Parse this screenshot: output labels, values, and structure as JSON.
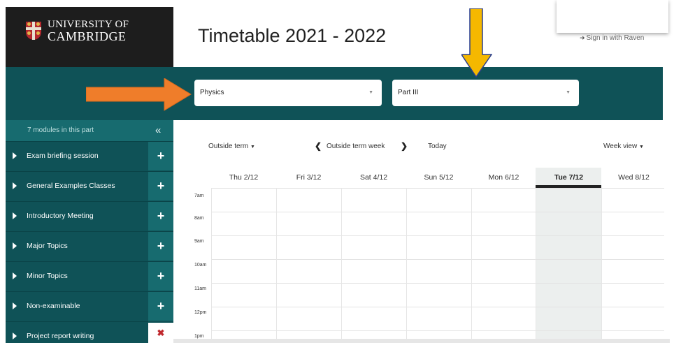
{
  "header": {
    "university_line1": "UNIVERSITY OF",
    "university_line2": "CAMBRIDGE",
    "title": "Timetable 2021 - 2022",
    "signin_label": "Sign in with Raven",
    "signin_icon": "sign-in-icon"
  },
  "filters": {
    "subject_value": "Physics",
    "part_value": "Part III"
  },
  "sidebar": {
    "module_count": "7 modules in this part",
    "collapse_icon": "double-chevron-left-icon",
    "items": [
      {
        "label": "Exam briefing session",
        "action": "add"
      },
      {
        "label": "General Examples Classes",
        "action": "add"
      },
      {
        "label": "Introductory Meeting",
        "action": "add"
      },
      {
        "label": "Major Topics",
        "action": "add"
      },
      {
        "label": "Minor Topics",
        "action": "add"
      },
      {
        "label": "Non-examinable",
        "action": "add"
      },
      {
        "label": "Project report writing",
        "action": "remove"
      }
    ]
  },
  "calendar": {
    "term_label": "Outside term",
    "week_label": "Outside term week",
    "today_label": "Today",
    "view_label": "Week view",
    "days": [
      "Thu 2/12",
      "Fri 3/12",
      "Sat 4/12",
      "Sun 5/12",
      "Mon 6/12",
      "Tue 7/12",
      "Wed 8/12"
    ],
    "active_day": "Tue 7/12",
    "hours": [
      "7am",
      "8am",
      "9am",
      "10am",
      "11am",
      "12pm",
      "1pm"
    ]
  },
  "annotations": {
    "orange_arrow_color": "#ef7d2a",
    "yellow_arrow_color": "#f5b800"
  },
  "colors": {
    "brand_teal": "#0f5257",
    "brand_teal_light": "#176b6f",
    "remove_red": "#c0282d"
  }
}
